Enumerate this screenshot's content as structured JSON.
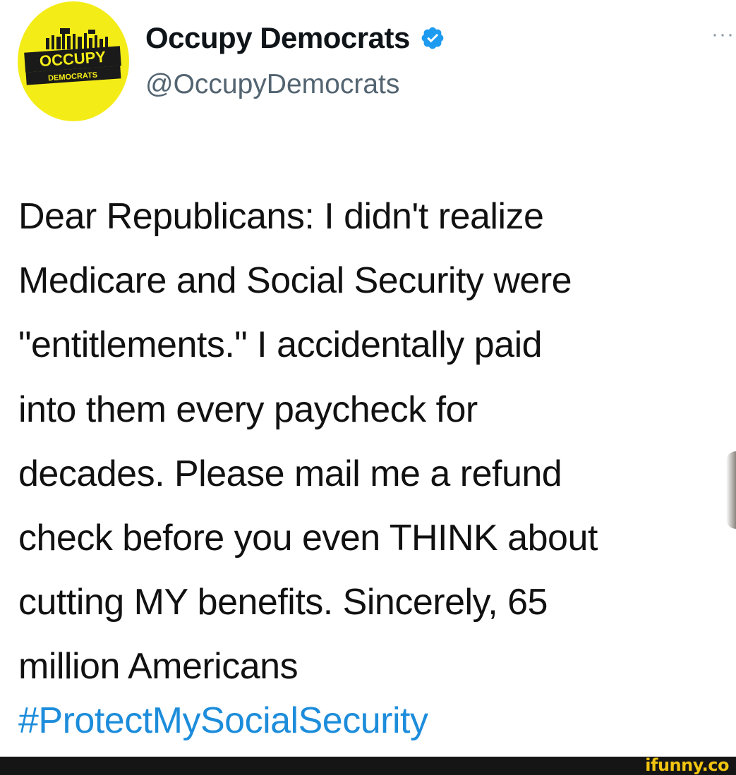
{
  "author": {
    "name": "Occupy Democrats",
    "handle": "@OccupyDemocrats",
    "avatar_text_line1": "OCCUPY",
    "avatar_text_line2": "DEMOCRATS",
    "verified": true
  },
  "more_label": "···",
  "tweet": {
    "text_lines": [
      "Dear Republicans: I didn't realize",
      "Medicare and Social Security were",
      "\"entitlements.\" I accidentally paid",
      "into them every paycheck for",
      "decades. Please mail me a refund",
      "check before you even THINK about",
      "cutting MY benefits. Sincerely, 65",
      "million Americans"
    ],
    "hashtag": "#ProtectMySocialSecurity"
  },
  "watermark": "ifunny.co",
  "colors": {
    "avatar_bg": "#f4ec17",
    "verified": "#1d9bf0",
    "hashtag": "#1d8ddb",
    "handle": "#536471",
    "footer": "#151516",
    "watermark": "#f1c40f"
  }
}
